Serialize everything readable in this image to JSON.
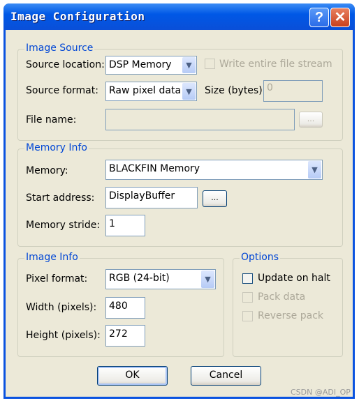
{
  "window": {
    "title": "Image Configuration",
    "help_icon": "question-mark",
    "close_icon": "x"
  },
  "image_source": {
    "legend": "Image Source",
    "source_location_label": "Source location:",
    "source_location_value": "DSP Memory",
    "write_stream_label": "Write entire file stream",
    "write_stream_checked": false,
    "source_format_label": "Source format:",
    "source_format_value": "Raw pixel data",
    "size_label": "Size (bytes):",
    "size_value": "0",
    "file_name_label": "File name:",
    "file_name_value": "",
    "browse_label": "..."
  },
  "memory_info": {
    "legend": "Memory Info",
    "memory_label": "Memory:",
    "memory_value": "BLACKFIN Memory",
    "start_address_label": "Start address:",
    "start_address_value": "DisplayBuffer",
    "browse_label": "...",
    "stride_label": "Memory stride:",
    "stride_value": "1"
  },
  "image_info": {
    "legend": "Image Info",
    "pixel_format_label": "Pixel format:",
    "pixel_format_value": "RGB (24-bit)",
    "width_label": "Width (pixels):",
    "width_value": "480",
    "height_label": "Height (pixels):",
    "height_value": "272"
  },
  "options": {
    "legend": "Options",
    "update_on_halt": "Update on halt",
    "update_on_halt_checked": false,
    "pack_data": "Pack data",
    "reverse_pack": "Reverse pack"
  },
  "buttons": {
    "ok": "OK",
    "cancel": "Cancel"
  },
  "watermark": "CSDN @ADI_OP"
}
